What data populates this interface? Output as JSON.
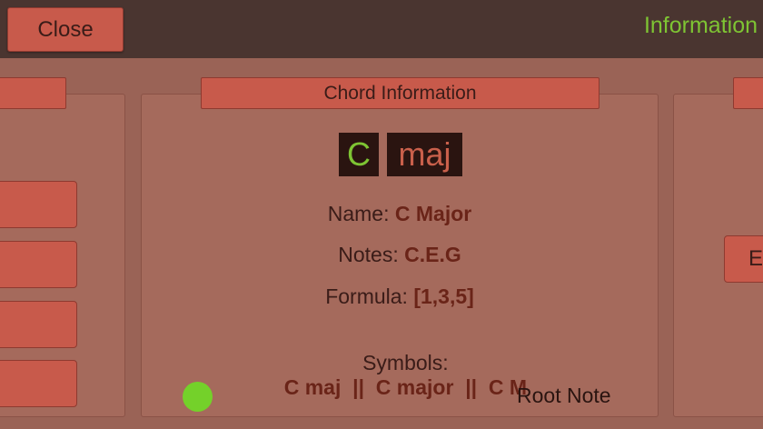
{
  "topbar": {
    "close_label": "Close",
    "title": "Information"
  },
  "panels": {
    "center_tab": "Chord Information",
    "right_button_label": "E"
  },
  "chord": {
    "root": "C",
    "type": "maj"
  },
  "info": {
    "name_label": "Name:",
    "name_value": "C Major",
    "notes_label": "Notes:",
    "notes_value": "C.E.G",
    "formula_label": "Formula:",
    "formula_value": "[1,3,5]",
    "symbols_label": "Symbols:",
    "symbols_value": "C maj  ||  C major  ||  C M"
  },
  "legend": {
    "root_note_label": "Root Note"
  },
  "colors": {
    "root_accent": "#74d12a",
    "button": "#c85a4b",
    "topbar": "#4a3530"
  }
}
